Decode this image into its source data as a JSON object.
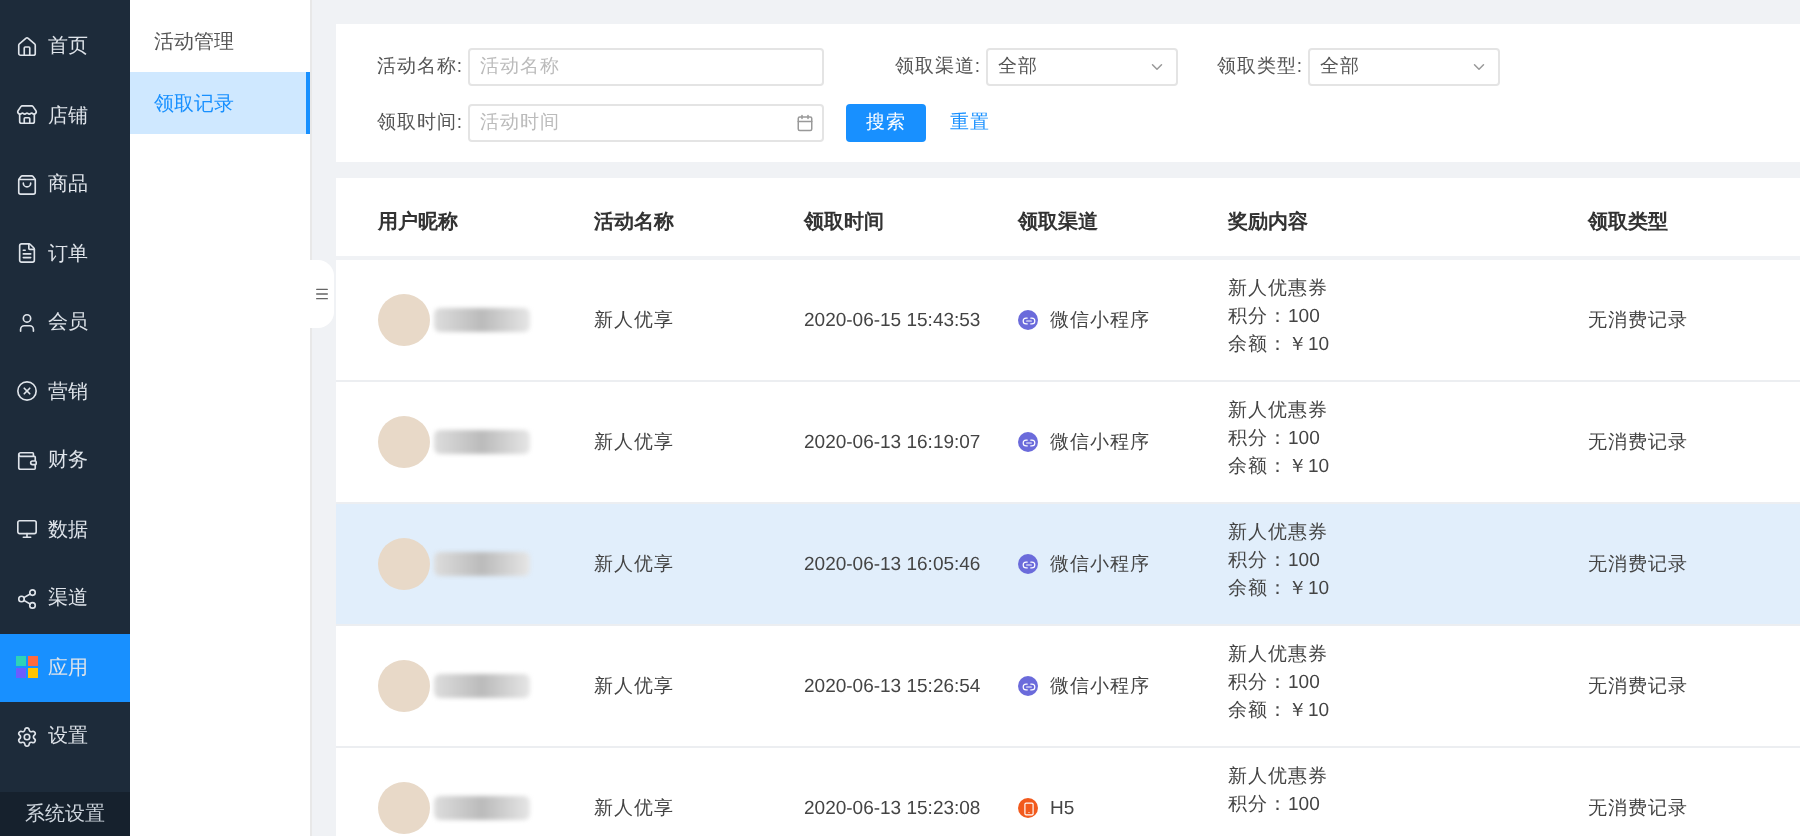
{
  "sidebar": {
    "items": [
      {
        "label": "首页",
        "kind": "home",
        "selected": false
      },
      {
        "label": "店铺",
        "kind": "store",
        "selected": false
      },
      {
        "label": "商品",
        "kind": "goods",
        "selected": false
      },
      {
        "label": "订单",
        "kind": "order",
        "selected": false
      },
      {
        "label": "会员",
        "kind": "member",
        "selected": false
      },
      {
        "label": "营销",
        "kind": "marketing",
        "selected": false
      },
      {
        "label": "财务",
        "kind": "finance",
        "selected": false
      },
      {
        "label": "数据",
        "kind": "data",
        "selected": false
      },
      {
        "label": "渠道",
        "kind": "channel",
        "selected": false
      },
      {
        "label": "应用",
        "kind": "apps",
        "selected": true
      },
      {
        "label": "设置",
        "kind": "settings",
        "selected": false
      }
    ],
    "footer": "系统设置"
  },
  "submenu": {
    "items": [
      {
        "label": "活动管理",
        "selected": false
      },
      {
        "label": "领取记录",
        "selected": true
      }
    ]
  },
  "filters": {
    "name": {
      "label": "活动名称:",
      "placeholder": "活动名称"
    },
    "channel": {
      "label": "领取渠道:",
      "value": "全部"
    },
    "type": {
      "label": "领取类型:",
      "value": "全部"
    },
    "time": {
      "label": "领取时间:",
      "placeholder": "活动时间"
    },
    "search_button": "搜索",
    "reset_link": "重置"
  },
  "table": {
    "columns": [
      "用户昵称",
      "活动名称",
      "领取时间",
      "领取渠道",
      "奖励内容",
      "领取类型"
    ],
    "rows": [
      {
        "hovered": false,
        "activity": "新人优享",
        "time": "2020-06-15 15:43:53",
        "channel": {
          "kind": "wechat",
          "label": "微信小程序"
        },
        "reward": [
          "新人优惠券",
          "积分：100",
          "余额：￥10"
        ],
        "type": "无消费记录"
      },
      {
        "hovered": false,
        "activity": "新人优享",
        "time": "2020-06-13 16:19:07",
        "channel": {
          "kind": "wechat",
          "label": "微信小程序"
        },
        "reward": [
          "新人优惠券",
          "积分：100",
          "余额：￥10"
        ],
        "type": "无消费记录"
      },
      {
        "hovered": true,
        "activity": "新人优享",
        "time": "2020-06-13 16:05:46",
        "channel": {
          "kind": "wechat",
          "label": "微信小程序"
        },
        "reward": [
          "新人优惠券",
          "积分：100",
          "余额：￥10"
        ],
        "type": "无消费记录"
      },
      {
        "hovered": false,
        "activity": "新人优享",
        "time": "2020-06-13 15:26:54",
        "channel": {
          "kind": "wechat",
          "label": "微信小程序"
        },
        "reward": [
          "新人优惠券",
          "积分：100",
          "余额：￥10"
        ],
        "type": "无消费记录"
      },
      {
        "hovered": false,
        "activity": "新人优享",
        "time": "2020-06-13 15:23:08",
        "channel": {
          "kind": "h5",
          "label": "H5"
        },
        "reward": [
          "新人优惠券",
          "积分：100"
        ],
        "type": "无消费记录"
      }
    ]
  }
}
